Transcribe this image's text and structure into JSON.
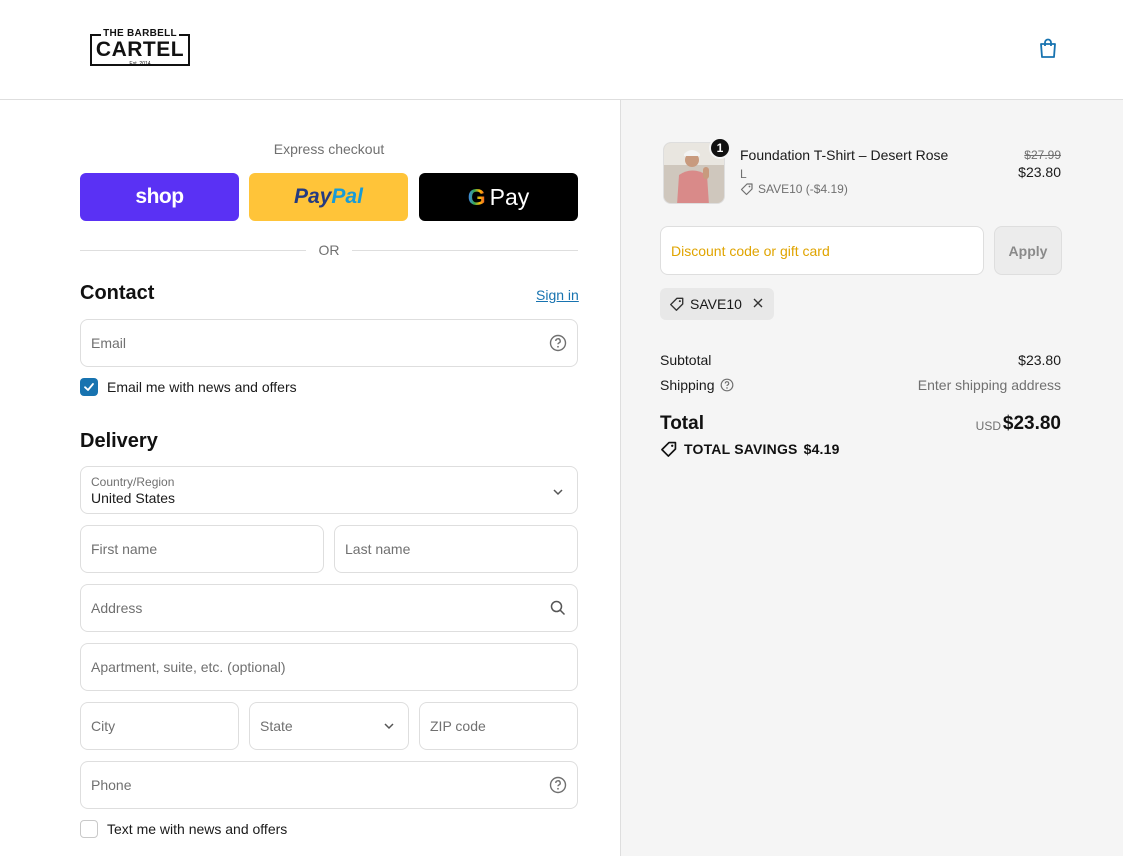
{
  "brand": {
    "logo_top": "THE BARBELL",
    "logo_main": "CARTEL",
    "logo_est": "Est. 2014"
  },
  "header": {
    "cart_icon": "shopping-bag-icon"
  },
  "express": {
    "title": "Express checkout",
    "shop_label": "shop",
    "paypal_label_1": "Pay",
    "paypal_label_2": "Pal",
    "gpay_g": "G",
    "gpay_label": "Pay",
    "or_label": "OR"
  },
  "contact": {
    "title": "Contact",
    "sign_in": "Sign in",
    "email_placeholder": "Email",
    "newsletter_label": "Email me with news and offers",
    "newsletter_checked": true
  },
  "delivery": {
    "title": "Delivery",
    "country_label": "Country/Region",
    "country_value": "United States",
    "first_name_placeholder": "First name",
    "last_name_placeholder": "Last name",
    "address_placeholder": "Address",
    "apartment_placeholder": "Apartment, suite, etc. (optional)",
    "city_placeholder": "City",
    "state_placeholder": "State",
    "zip_placeholder": "ZIP code",
    "phone_placeholder": "Phone",
    "sms_label": "Text me with news and offers",
    "sms_checked": false
  },
  "order": {
    "quantity": "1",
    "product_name": "Foundation T-Shirt – Desert Rose",
    "variant": "L",
    "discount_line": "SAVE10 (-$4.19)",
    "old_price": "$27.99",
    "new_price": "$23.80"
  },
  "discount": {
    "placeholder": "Discount code or gift card",
    "apply_label": "Apply",
    "applied_code": "SAVE10"
  },
  "summary": {
    "subtotal_label": "Subtotal",
    "subtotal_value": "$23.80",
    "shipping_label": "Shipping",
    "shipping_value": "Enter shipping address",
    "total_label": "Total",
    "currency": "USD",
    "total_value": "$23.80",
    "savings_label": "TOTAL SAVINGS",
    "savings_value": "$4.19"
  },
  "colors": {
    "shop_purple": "#5a31f4",
    "paypal_yellow": "#ffc439",
    "link_blue": "#1773b0",
    "discount_placeholder": "#e0a400"
  }
}
